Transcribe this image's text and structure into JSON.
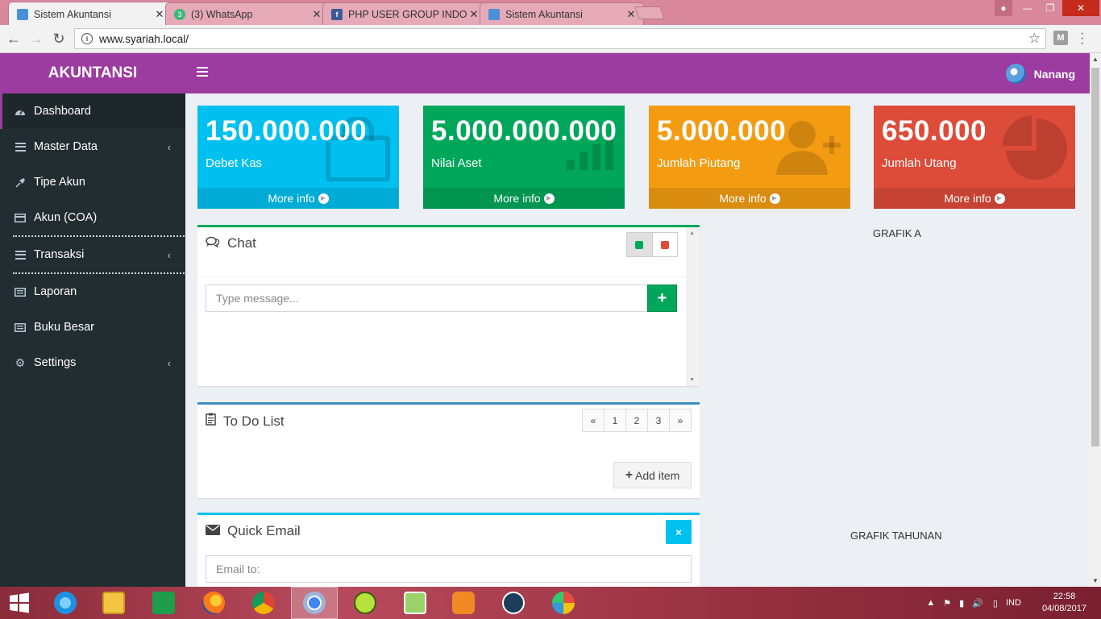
{
  "browser": {
    "tabs": [
      {
        "label": "Sistem Akuntansi",
        "active": true,
        "icon": "calendar-icon"
      },
      {
        "label": "(3) WhatsApp",
        "active": false,
        "icon": "whatsapp-icon",
        "badge": "3"
      },
      {
        "label": "PHP USER GROUP INDO",
        "active": false,
        "icon": "facebook-icon"
      },
      {
        "label": "Sistem Akuntansi",
        "active": false,
        "icon": "calendar-icon"
      }
    ],
    "url": "www.syariah.local/",
    "extension_label": "M"
  },
  "header": {
    "brand": "AKUNTANSI",
    "user_name": "Nanang"
  },
  "sidebar": {
    "items": [
      {
        "label": "Dashboard",
        "icon": "dashboard-icon",
        "active": true
      },
      {
        "label": "Master Data",
        "icon": "list-icon",
        "has_children": true
      },
      {
        "label": "Tipe Akun",
        "icon": "pushpin-icon"
      },
      {
        "label": "Akun (COA)",
        "icon": "card-icon"
      },
      {
        "label": "Transaksi",
        "icon": "list-icon",
        "has_children": true
      },
      {
        "label": "Laporan",
        "icon": "newspaper-icon"
      },
      {
        "label": "Buku Besar",
        "icon": "newspaper-icon"
      },
      {
        "label": "Settings",
        "icon": "gear-icon",
        "has_children": true
      }
    ]
  },
  "stats": [
    {
      "value": "150.000.000",
      "label": "Debet Kas",
      "footer": "More info",
      "color": "#00c0ef",
      "icon": "shopping-bag-icon"
    },
    {
      "value": "5.000.000.000",
      "label": "Nilai Aset",
      "footer": "More info",
      "color": "#00a65a",
      "icon": "bar-chart-icon"
    },
    {
      "value": "5.000.000",
      "label": "Jumlah Piutang",
      "footer": "More info",
      "color": "#f39c12",
      "icon": "user-plus-icon"
    },
    {
      "value": "650.000",
      "label": "Jumlah Utang",
      "footer": "More info",
      "color": "#dd4b39",
      "icon": "pie-chart-icon"
    }
  ],
  "chat": {
    "title": "Chat",
    "placeholder": "Type message...",
    "send_label": "+"
  },
  "todo": {
    "title": "To Do List",
    "pager": [
      "«",
      "1",
      "2",
      "3",
      "»"
    ],
    "add_label": "Add item"
  },
  "email": {
    "title": "Quick Email",
    "to_placeholder": "Email to:",
    "close_label": "×"
  },
  "charts": {
    "grafik_a": "GRAFIK A",
    "grafik_tahunan": "GRAFIK TAHUNAN"
  },
  "taskbar": {
    "language": "IND",
    "time": "22:58",
    "date": "04/08/2017",
    "apps": [
      "windows-start-icon",
      "internet-explorer-icon",
      "file-explorer-icon",
      "store-icon",
      "firefox-icon",
      "chrome-icon",
      "chrome-active-icon",
      "hs-icon",
      "notepad-icon",
      "media-player-icon",
      "app-tree-icon",
      "paint-icon"
    ]
  }
}
